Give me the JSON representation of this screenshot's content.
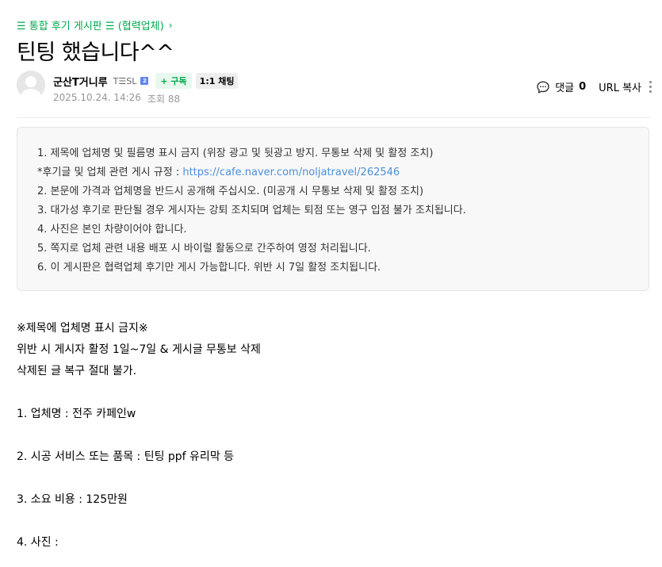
{
  "breadcrumb": {
    "board": "☰ 통합 후기 게시판 ☰ (협력업체)",
    "chevron": "›"
  },
  "post": {
    "title": "틴팅 했습니다^^"
  },
  "author": {
    "nickname": "군산T거니루",
    "level_text": "T☰SL",
    "level_badge": "2",
    "subscribe_label": "+ 구독",
    "chat_label": "1:1 채팅",
    "date": "2025.10.24. 14:26",
    "views": "조회 88"
  },
  "actions": {
    "comment_label": "댓글",
    "comment_count": "0",
    "url_copy_label": "URL 복사"
  },
  "notice": {
    "line1": "1. 제목에 업체명 및 필름명 표시 금지 (위장 광고 및 뒷광고 방지. 무통보 삭제 및 활정 조치)",
    "line2_prefix": "*후기글 및 업체 관련 게시 규정 : ",
    "line2_link": "https://cafe.naver.com/noljatravel/262546",
    "line3": "2. 본문에 가격과 업체명을 반드시 공개해 주십시오. (미공개 시 무통보 삭제 및 활정 조치)",
    "line4": "3. 대가성 후기로 판단될 경우 게시자는 강퇴 조치되며 업체는 퇴점 또는 영구 입점 불가 조치됩니다.",
    "line5": "4. 사진은 본인 차량이어야 합니다.",
    "line6": "5. 쪽지로 업체 관련 내용 배포 시 바이럴 활동으로 간주하여 영정 처리됩니다.",
    "line7": "6. 이 게시판은 협력업체 후기만 게시 가능합니다. 위반 시 7일 활정 조치됩니다."
  },
  "content": {
    "line1": "※제목에 업체명 표시 금지※",
    "line2": "위반 시 게시자 활정 1일~7일 & 게시글 무통보 삭제",
    "line3": "삭제된 글 복구 절대 불가.",
    "line4": "1. 업체명 :  전주 카페인w",
    "line5": "2. 시공 서비스 또는 품목 :  틴팅 ppf 유리막 등",
    "line6": "3. 소요 비용 :  125만원",
    "line7": "4. 사진 :"
  },
  "icons": {
    "comment": "comment-bubble-icon",
    "more": "more-vertical-icon",
    "avatar": "default-avatar-icon"
  },
  "colors": {
    "accent_green": "#03a94d",
    "link_blue": "#4a90d9"
  }
}
